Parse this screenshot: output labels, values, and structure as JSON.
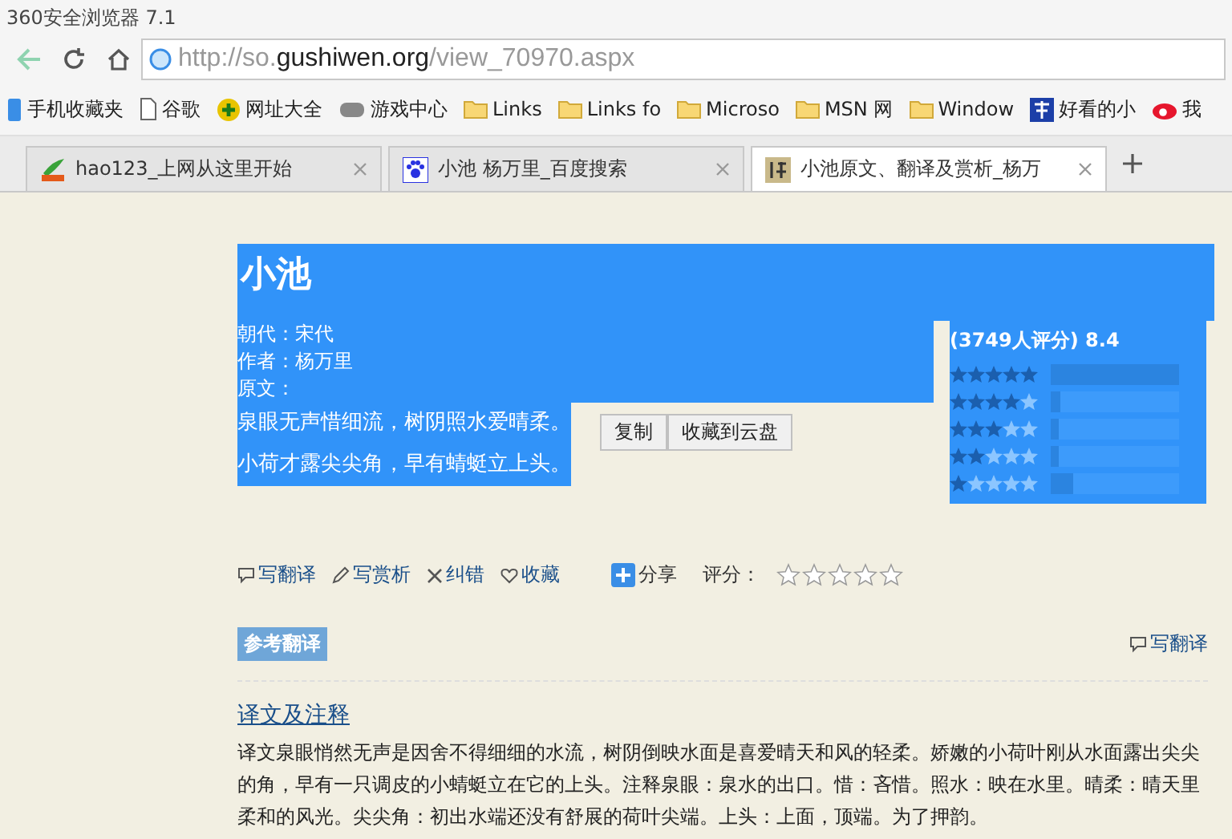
{
  "window": {
    "title": "360安全浏览器 7.1"
  },
  "address": {
    "prefix": "http://so.",
    "domain": "gushiwen.org",
    "path": "/view_70970.aspx"
  },
  "bookmarks": [
    {
      "label": "手机收藏夹",
      "kind": "phone"
    },
    {
      "label": "谷歌",
      "kind": "page"
    },
    {
      "label": "网址大全",
      "kind": "plus"
    },
    {
      "label": "游戏中心",
      "kind": "game"
    },
    {
      "label": "Links",
      "kind": "folder"
    },
    {
      "label": "Links fo",
      "kind": "folder"
    },
    {
      "label": "Microso",
      "kind": "folder"
    },
    {
      "label": "MSN 网",
      "kind": "folder"
    },
    {
      "label": "Window",
      "kind": "folder"
    },
    {
      "label": "好看的小",
      "kind": "book"
    },
    {
      "label": "我",
      "kind": "weibo"
    }
  ],
  "tabs": [
    {
      "label": "hao123_上网从这里开始",
      "selected": false,
      "kind": "hao"
    },
    {
      "label": "小池 杨万里_百度搜索",
      "selected": false,
      "kind": "paw"
    },
    {
      "label": "小池原文、翻译及赏析_杨万",
      "selected": true,
      "kind": "poem"
    }
  ],
  "poem": {
    "title": "小池",
    "dynasty": "朝代：宋代",
    "author": "作者：杨万里",
    "original_label": "原文：",
    "lines": [
      "泉眼无声惜细流，树阴照水爱晴柔。",
      "小荷才露尖尖角，早有蜻蜓立上头。"
    ]
  },
  "selection_menu": [
    "复制",
    "收藏到云盘"
  ],
  "rating": {
    "summary": "(3749人评分) 8.4",
    "rows": [
      {
        "stars": 5,
        "level": 1.0
      },
      {
        "stars": 4,
        "level": 0.08
      },
      {
        "stars": 3,
        "level": 0.06
      },
      {
        "stars": 2,
        "level": 0.06
      },
      {
        "stars": 1,
        "level": 0.18
      }
    ]
  },
  "actions": [
    {
      "label": "写翻译",
      "kind": "comment"
    },
    {
      "label": "写赏析",
      "kind": "pencil"
    },
    {
      "label": "纠错",
      "kind": "cross"
    },
    {
      "label": "收藏",
      "kind": "heart"
    }
  ],
  "share": "分享",
  "score": {
    "label": "评分：",
    "stars": 0
  },
  "section": {
    "badge": "参考翻译",
    "write_link": "写翻译",
    "heading": "译文及注释",
    "body": "译文泉眼悄然无声是因舍不得细细的水流，树阴倒映水面是喜爱晴天和风的轻柔。娇嫩的小荷叶刚从水面露出尖尖的角，早有一只调皮的小蜻蜓立在它的上头。注释泉眼：泉水的出口。惜：吝惜。照水：映在水里。晴柔：晴天里柔和的风光。尖尖角：初出水端还没有舒展的荷叶尖端。上头：上面，顶端。为了押韵。"
  }
}
